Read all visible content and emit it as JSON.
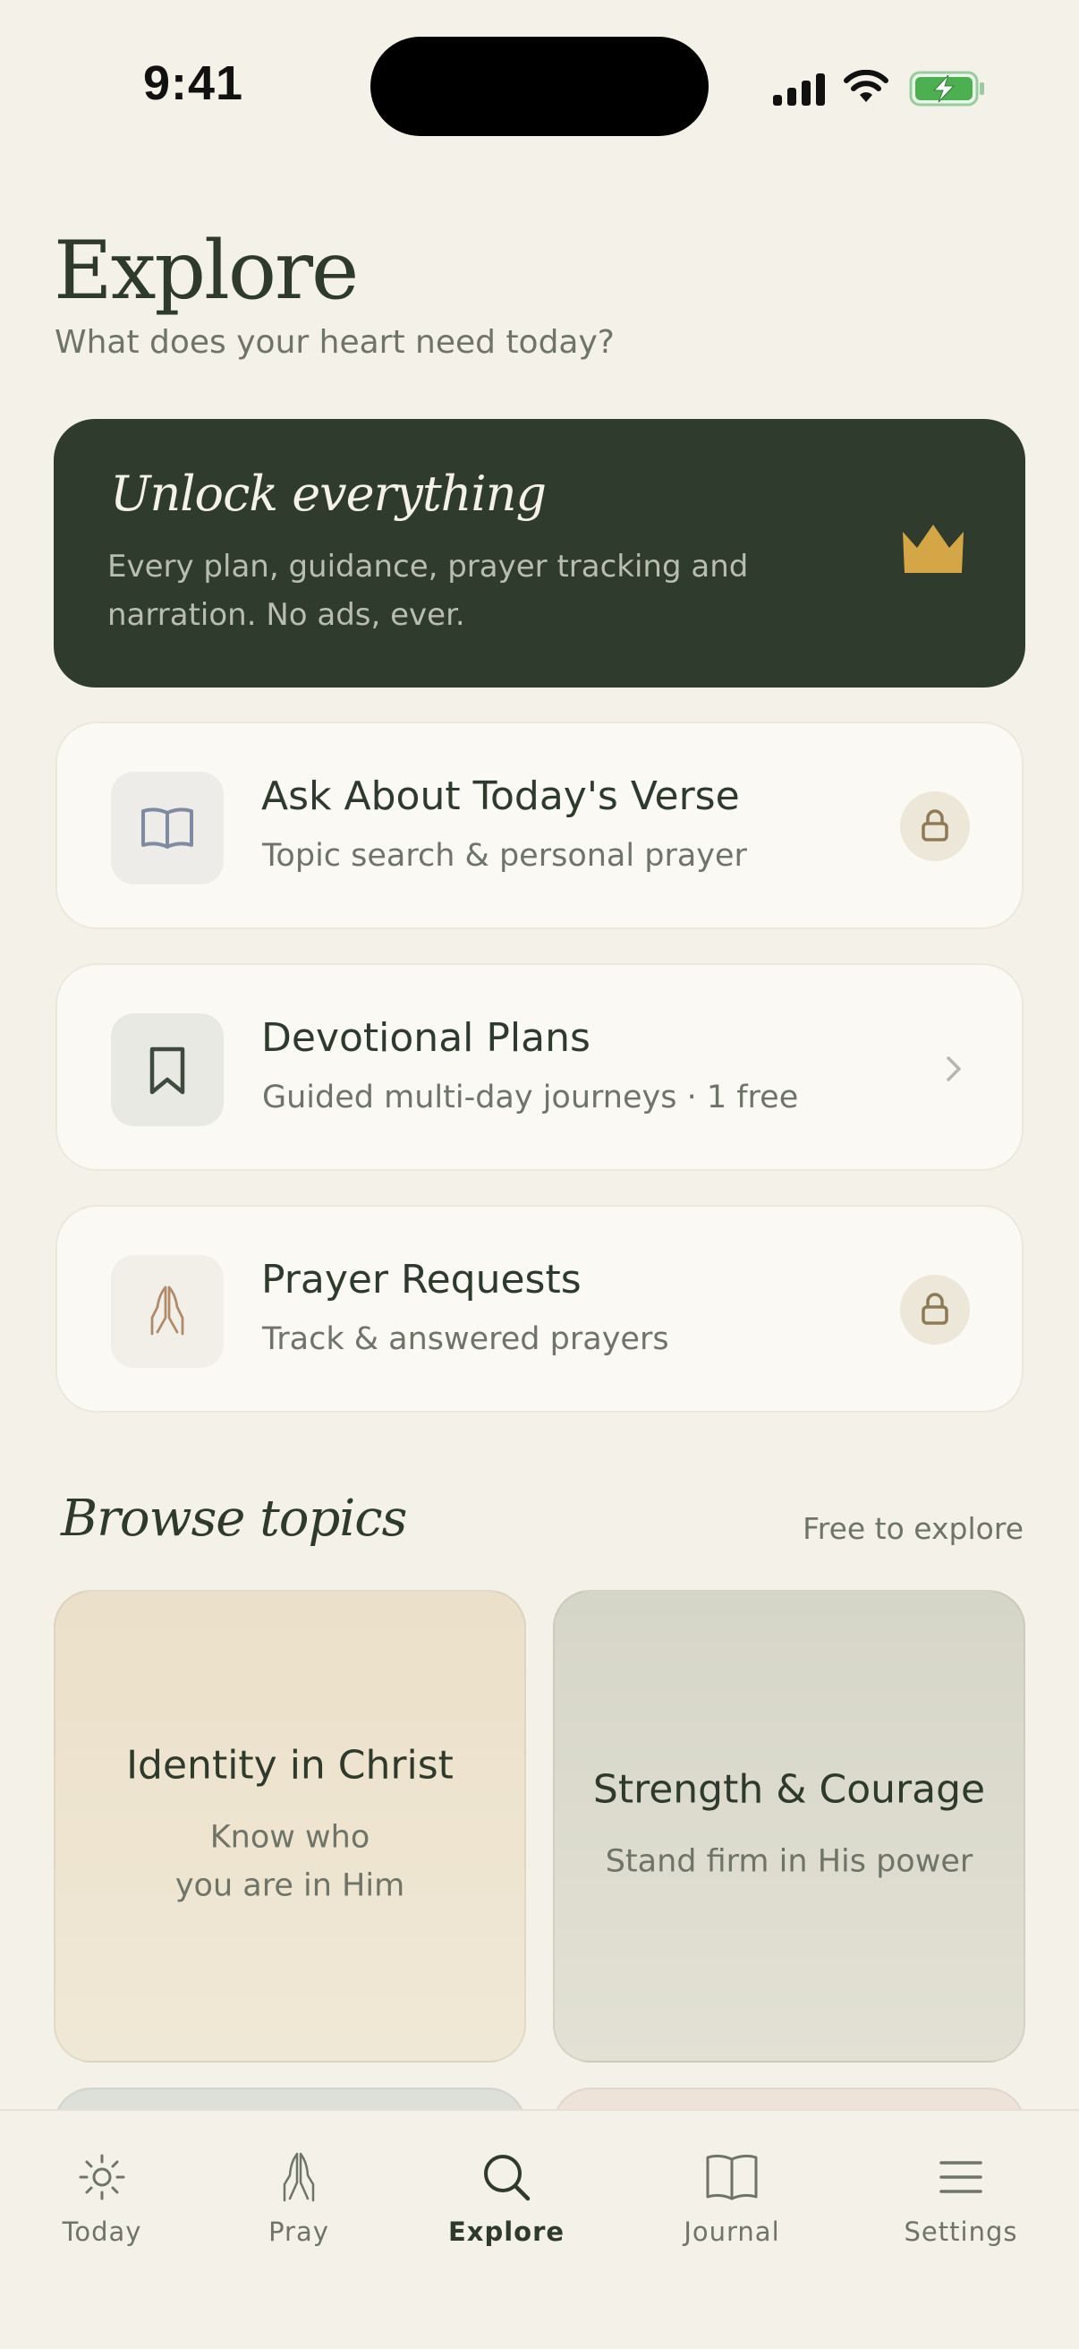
{
  "status_bar": {
    "time": "9:41",
    "icons": [
      "signal-icon",
      "wifi-icon",
      "battery-charging-icon"
    ]
  },
  "header": {
    "title": "Explore",
    "subtitle": "What does your heart need today?"
  },
  "unlock": {
    "title": "Unlock everything",
    "description": "Every plan, guidance, prayer tracking and narration. No ads, ever.",
    "icon": "crown-icon",
    "accent": "#D4A646"
  },
  "features": [
    {
      "title": "Ask About Today's Verse",
      "subtitle": "Topic search & personal prayer",
      "icon": "book-icon",
      "trailing": "lock-icon"
    },
    {
      "title": "Devotional Plans",
      "subtitle": "Guided multi-day journeys · 1 free",
      "icon": "bookmark-icon",
      "trailing": "chevron-right-icon"
    },
    {
      "title": "Prayer Requests",
      "subtitle": "Track & answered prayers",
      "icon": "praying-hands-icon",
      "trailing": "lock-icon"
    }
  ],
  "browse": {
    "title": "Browse topics",
    "aside": "Free to explore",
    "topics": [
      {
        "title": "Identity in Christ",
        "subtitle": "Know who\nyou are in Him"
      },
      {
        "title": "Strength & Courage",
        "subtitle": "Stand firm in His power"
      }
    ]
  },
  "tabs": [
    {
      "label": "Today",
      "icon": "sun-icon"
    },
    {
      "label": "Pray",
      "icon": "praying-hands-icon"
    },
    {
      "label": "Explore",
      "icon": "search-icon",
      "active": true
    },
    {
      "label": "Journal",
      "icon": "book-open-icon"
    },
    {
      "label": "Settings",
      "icon": "menu-icon"
    }
  ],
  "colors": {
    "background": "#F4F1E8",
    "primary_dark": "#2F3B2D",
    "card": "#FAF9F4",
    "muted_text": "#6F7468"
  }
}
